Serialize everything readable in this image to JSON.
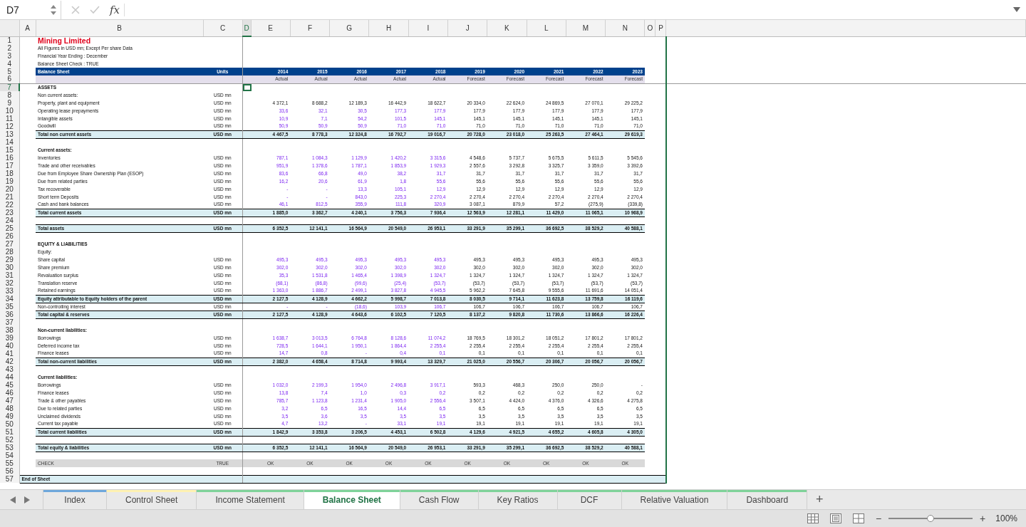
{
  "formula_bar": {
    "name_box": "D7",
    "function_label": "fx"
  },
  "columns": [
    {
      "letter": "A",
      "selected": false
    },
    {
      "letter": "B",
      "selected": false
    },
    {
      "letter": "C",
      "selected": false
    },
    {
      "letter": "D",
      "selected": true
    },
    {
      "letter": "E",
      "selected": false
    },
    {
      "letter": "F",
      "selected": false
    },
    {
      "letter": "G",
      "selected": false
    },
    {
      "letter": "H",
      "selected": false
    },
    {
      "letter": "I",
      "selected": false
    },
    {
      "letter": "J",
      "selected": false
    },
    {
      "letter": "K",
      "selected": false
    },
    {
      "letter": "L",
      "selected": false
    },
    {
      "letter": "M",
      "selected": false
    },
    {
      "letter": "N",
      "selected": false
    },
    {
      "letter": "O",
      "selected": false
    },
    {
      "letter": "P",
      "selected": false
    }
  ],
  "periods": [
    {
      "year": "2014",
      "basis": "Actual",
      "kind": "actual"
    },
    {
      "year": "2015",
      "basis": "Actual",
      "kind": "actual"
    },
    {
      "year": "2016",
      "basis": "Actual",
      "kind": "actual"
    },
    {
      "year": "2017",
      "basis": "Actual",
      "kind": "actual"
    },
    {
      "year": "2018",
      "basis": "Actual",
      "kind": "actual"
    },
    {
      "year": "2019",
      "basis": "Forecast",
      "kind": "forecast"
    },
    {
      "year": "2020",
      "basis": "Forecast",
      "kind": "forecast"
    },
    {
      "year": "2021",
      "basis": "Forecast",
      "kind": "forecast"
    },
    {
      "year": "2022",
      "basis": "Forecast",
      "kind": "forecast"
    },
    {
      "year": "2023",
      "basis": "Forecast",
      "kind": "forecast"
    }
  ],
  "rows": [
    {
      "n": "1",
      "kind": "title",
      "label": "Mining Limited",
      "selected": false
    },
    {
      "n": "2",
      "kind": "note",
      "label": "All Figures in USD mn; Except Per share Data",
      "selected": false
    },
    {
      "n": "3",
      "kind": "note",
      "label": "Financial Year Ending : December",
      "selected": false
    },
    {
      "n": "4",
      "kind": "note",
      "label": "Balance Sheet Check : TRUE",
      "selected": false
    },
    {
      "n": "5",
      "kind": "header",
      "label": "Balance Sheet",
      "units": "Units",
      "selected": false
    },
    {
      "n": "6",
      "kind": "subheader",
      "selected": false
    },
    {
      "n": "7",
      "kind": "section",
      "label": "ASSETS",
      "selected": true
    },
    {
      "n": "8",
      "kind": "item",
      "label": "Non current assets:",
      "units": "USD mn",
      "selected": false
    },
    {
      "n": "9",
      "kind": "item",
      "label": "Property, plant and equipment",
      "units": "USD mn",
      "input": false,
      "selected": false,
      "values": [
        "4 372,1",
        "8 688,2",
        "12 189,3",
        "16 442,9",
        "18 622,7",
        "20 334,0",
        "22 624,0",
        "24 869,5",
        "27 070,1",
        "29 225,2"
      ]
    },
    {
      "n": "10",
      "kind": "item",
      "label": "Operating lease prepayments",
      "units": "USD mn",
      "input": true,
      "selected": false,
      "values": [
        "33,6",
        "32,1",
        "30,5",
        "177,3",
        "177,9",
        "177,9",
        "177,9",
        "177,9",
        "177,9",
        "177,9"
      ]
    },
    {
      "n": "11",
      "kind": "item",
      "label": "Intangible assets",
      "units": "USD mn",
      "input": true,
      "selected": false,
      "values": [
        "10,9",
        "7,1",
        "54,2",
        "101,5",
        "145,1",
        "145,1",
        "145,1",
        "145,1",
        "145,1",
        "145,1"
      ]
    },
    {
      "n": "12",
      "kind": "item",
      "label": "Goodwill",
      "units": "USD mn",
      "input": true,
      "selected": false,
      "values": [
        "50,9",
        "50,9",
        "50,9",
        "71,0",
        "71,0",
        "71,0",
        "71,0",
        "71,0",
        "71,0",
        "71,0"
      ]
    },
    {
      "n": "13",
      "kind": "total",
      "label": "Total non current assets",
      "units": "USD mn",
      "selected": false,
      "values": [
        "4 467,5",
        "8 778,3",
        "12 324,8",
        "16 792,7",
        "19 016,7",
        "20 728,0",
        "23 018,0",
        "25 263,5",
        "27 464,1",
        "29 619,3"
      ]
    },
    {
      "n": "14",
      "kind": "blank",
      "selected": false
    },
    {
      "n": "15",
      "kind": "section",
      "label": "Current assets:",
      "selected": false
    },
    {
      "n": "16",
      "kind": "item",
      "label": "Inventories",
      "units": "USD mn",
      "input": true,
      "selected": false,
      "values": [
        "787,1",
        "1 084,3",
        "1 129,9",
        "1 420,2",
        "3 315,6",
        "4 548,6",
        "5 737,7",
        "5 675,5",
        "5 611,5",
        "5 545,6"
      ]
    },
    {
      "n": "17",
      "kind": "item",
      "label": "Trade and other receivables",
      "units": "USD mn",
      "input": true,
      "selected": false,
      "values": [
        "951,9",
        "1 378,6",
        "1 787,1",
        "1 853,9",
        "1 929,3",
        "2 557,6",
        "3 292,8",
        "3 325,7",
        "3 359,0",
        "3 392,6"
      ]
    },
    {
      "n": "18",
      "kind": "item",
      "label": "Due from Employee Share Ownership Plan (ESOP)",
      "units": "USD mn",
      "input": true,
      "selected": false,
      "values": [
        "83,6",
        "66,8",
        "49,0",
        "38,2",
        "31,7",
        "31,7",
        "31,7",
        "31,7",
        "31,7",
        "31,7"
      ]
    },
    {
      "n": "19",
      "kind": "item",
      "label": "Due from related parties",
      "units": "USD mn",
      "input": true,
      "selected": false,
      "values": [
        "16,2",
        "20,6",
        "61,9",
        "1,8",
        "55,6",
        "55,6",
        "55,6",
        "55,6",
        "55,6",
        "55,6"
      ]
    },
    {
      "n": "20",
      "kind": "item",
      "label": "Tax recoverable",
      "units": "USD mn",
      "input": true,
      "selected": false,
      "values": [
        "-",
        "-",
        "13,3",
        "105,1",
        "12,9",
        "12,9",
        "12,9",
        "12,9",
        "12,9",
        "12,9"
      ]
    },
    {
      "n": "21",
      "kind": "item",
      "label": "Short term Deposits",
      "units": "USD mn",
      "input": true,
      "selected": false,
      "values": [
        "-",
        "-",
        "843,0",
        "225,3",
        "2 270,4",
        "2 270,4",
        "2 270,4",
        "2 270,4",
        "2 270,4",
        "2 270,4"
      ]
    },
    {
      "n": "22",
      "kind": "item",
      "label": "Cash and bank balances",
      "units": "USD mn",
      "input": true,
      "selected": false,
      "values": [
        "46,1",
        "812,5",
        "355,9",
        "111,8",
        "320,9",
        "3 087,1",
        "879,9",
        "57,2",
        "(275,9)",
        "(339,8)"
      ]
    },
    {
      "n": "23",
      "kind": "total",
      "label": "Total current assets",
      "units": "USD mn",
      "selected": false,
      "values": [
        "1 885,0",
        "3 362,7",
        "4 240,1",
        "3 756,3",
        "7 936,4",
        "12 563,9",
        "12 281,1",
        "11 429,0",
        "11 065,1",
        "10 968,9"
      ]
    },
    {
      "n": "24",
      "kind": "blank",
      "selected": false
    },
    {
      "n": "25",
      "kind": "total",
      "label": "Total assets",
      "units": "USD mn",
      "selected": false,
      "values": [
        "6 352,5",
        "12 141,1",
        "16 564,9",
        "20 549,0",
        "26 953,1",
        "33 291,9",
        "35 299,1",
        "36 692,5",
        "38 529,2",
        "40 588,1"
      ]
    },
    {
      "n": "26",
      "kind": "blank",
      "selected": false
    },
    {
      "n": "27",
      "kind": "section",
      "label": "EQUITY & LIABILITIES",
      "selected": false
    },
    {
      "n": "28",
      "kind": "item",
      "label": "Equity:",
      "selected": false
    },
    {
      "n": "29",
      "kind": "item",
      "label": "Share capital",
      "units": "USD mn",
      "input": true,
      "selected": false,
      "values": [
        "495,3",
        "495,3",
        "495,3",
        "495,3",
        "495,3",
        "495,3",
        "495,3",
        "495,3",
        "495,3",
        "495,3"
      ]
    },
    {
      "n": "30",
      "kind": "item",
      "label": "Share premium",
      "units": "USD mn",
      "input": true,
      "selected": false,
      "values": [
        "302,0",
        "302,0",
        "302,0",
        "302,0",
        "302,0",
        "302,0",
        "302,0",
        "302,0",
        "302,0",
        "302,0"
      ]
    },
    {
      "n": "31",
      "kind": "item",
      "label": "Revaluation surplus",
      "units": "USD mn",
      "input": true,
      "selected": false,
      "values": [
        "35,3",
        "1 531,8",
        "1 465,4",
        "1 398,9",
        "1 324,7",
        "1 324,7",
        "1 324,7",
        "1 324,7",
        "1 324,7",
        "1 324,7"
      ]
    },
    {
      "n": "32",
      "kind": "item",
      "label": "Translation reserve",
      "units": "USD mn",
      "input": true,
      "selected": false,
      "values": [
        "(68,1)",
        "(86,8)",
        "(99,6)",
        "(25,4)",
        "(53,7)",
        "(53,7)",
        "(53,7)",
        "(53,7)",
        "(53,7)",
        "(53,7)"
      ]
    },
    {
      "n": "33",
      "kind": "item",
      "label": "Retained earnings",
      "units": "USD mn",
      "input": true,
      "selected": false,
      "values": [
        "1 363,0",
        "1 886,7",
        "2 499,1",
        "3 827,8",
        "4 945,5",
        "5 962,2",
        "7 645,8",
        "9 555,6",
        "11 691,6",
        "14 051,4"
      ]
    },
    {
      "n": "34",
      "kind": "total",
      "label": "Equity attributable to Equity holders of the parent",
      "units": "USD mn",
      "selected": false,
      "values": [
        "2 127,5",
        "4 128,9",
        "4 662,2",
        "5 998,7",
        "7 013,8",
        "8 030,5",
        "9 714,1",
        "11 623,8",
        "13 759,8",
        "16 119,6"
      ]
    },
    {
      "n": "35",
      "kind": "item",
      "label": "Non-controlling interest",
      "units": "USD mn",
      "input": true,
      "selected": false,
      "values": [
        "-",
        "-",
        "(18,6)",
        "103,9",
        "106,7",
        "106,7",
        "106,7",
        "106,7",
        "106,7",
        "106,7"
      ]
    },
    {
      "n": "36",
      "kind": "total",
      "label": "Total capital & reserves",
      "units": "USD mn",
      "selected": false,
      "values": [
        "2 127,5",
        "4 128,9",
        "4 643,6",
        "6 102,5",
        "7 120,5",
        "8 137,2",
        "9 820,8",
        "11 730,6",
        "13 866,6",
        "16 226,4"
      ]
    },
    {
      "n": "37",
      "kind": "blank",
      "selected": false
    },
    {
      "n": "38",
      "kind": "section",
      "label": "Non-current liabilities:",
      "selected": false
    },
    {
      "n": "39",
      "kind": "item",
      "label": "Borrowings",
      "units": "USD mn",
      "input": true,
      "selected": false,
      "values": [
        "1 638,7",
        "3 013,5",
        "6 764,8",
        "8 128,6",
        "11 074,2",
        "18 769,5",
        "18 301,2",
        "18 051,2",
        "17 801,2",
        "17 801,2"
      ]
    },
    {
      "n": "40",
      "kind": "item",
      "label": "Deferred income tax",
      "units": "USD mn",
      "input": true,
      "selected": false,
      "values": [
        "728,5",
        "1 644,1",
        "1 950,1",
        "1 864,4",
        "2 255,4",
        "2 255,4",
        "2 255,4",
        "2 255,4",
        "2 255,4",
        "2 255,4"
      ]
    },
    {
      "n": "41",
      "kind": "item",
      "label": "Finance leases",
      "units": "USD mn",
      "input": true,
      "selected": false,
      "values": [
        "14,7",
        "0,8",
        "-",
        "0,4",
        "0,1",
        "0,1",
        "0,1",
        "0,1",
        "0,1",
        "0,1"
      ]
    },
    {
      "n": "42",
      "kind": "total",
      "label": "Total non-current liabilities",
      "units": "USD mn",
      "selected": false,
      "values": [
        "2 382,0",
        "4 658,4",
        "8 714,8",
        "9 993,4",
        "13 329,7",
        "21 025,0",
        "20 556,7",
        "20 306,7",
        "20 056,7",
        "20 056,7"
      ]
    },
    {
      "n": "43",
      "kind": "blank",
      "selected": false
    },
    {
      "n": "44",
      "kind": "section",
      "label": "Current liabilities:",
      "selected": false
    },
    {
      "n": "45",
      "kind": "item",
      "label": "Borrowings",
      "units": "USD mn",
      "input": true,
      "selected": false,
      "values": [
        "1 032,0",
        "2 199,3",
        "1 954,0",
        "2 496,8",
        "3 917,1",
        "593,3",
        "468,3",
        "250,0",
        "250,0",
        "-"
      ]
    },
    {
      "n": "46",
      "kind": "item",
      "label": "Finance leases",
      "units": "USD mn",
      "input": true,
      "selected": false,
      "values": [
        "13,8",
        "7,4",
        "1,0",
        "0,3",
        "0,2",
        "0,2",
        "0,2",
        "0,2",
        "0,2",
        "0,2"
      ]
    },
    {
      "n": "47",
      "kind": "item",
      "label": "Trade & other payables",
      "units": "USD mn",
      "input": true,
      "selected": false,
      "values": [
        "785,7",
        "1 123,8",
        "1 231,4",
        "1 905,0",
        "2 556,4",
        "3 507,1",
        "4 424,0",
        "4 376,0",
        "4 326,6",
        "4 275,8"
      ]
    },
    {
      "n": "48",
      "kind": "item",
      "label": "Due to related parties",
      "units": "USD mn",
      "input": true,
      "selected": false,
      "values": [
        "3,2",
        "6,5",
        "16,5",
        "14,4",
        "6,5",
        "6,5",
        "6,5",
        "6,5",
        "6,5",
        "6,5"
      ]
    },
    {
      "n": "49",
      "kind": "item",
      "label": "Unclaimed dividends",
      "units": "USD mn",
      "input": true,
      "selected": false,
      "values": [
        "3,5",
        "3,6",
        "3,5",
        "3,5",
        "3,5",
        "3,5",
        "3,5",
        "3,5",
        "3,5",
        "3,5"
      ]
    },
    {
      "n": "50",
      "kind": "item",
      "label": "Current tax payable",
      "units": "USD mn",
      "input": true,
      "selected": false,
      "values": [
        "4,7",
        "13,2",
        "-",
        "33,1",
        "19,1",
        "19,1",
        "19,1",
        "19,1",
        "19,1",
        "19,1"
      ]
    },
    {
      "n": "51",
      "kind": "total",
      "label": "Total current liabilities",
      "units": "USD mn",
      "selected": false,
      "values": [
        "1 842,9",
        "3 353,8",
        "3 206,5",
        "4 453,1",
        "6 502,8",
        "4 129,6",
        "4 921,5",
        "4 655,2",
        "4 605,8",
        "4 305,0"
      ]
    },
    {
      "n": "52",
      "kind": "blank",
      "selected": false
    },
    {
      "n": "53",
      "kind": "total",
      "label": "Total equity & liabilities",
      "units": "USD mn",
      "selected": false,
      "values": [
        "6 352,5",
        "12 141,1",
        "16 564,9",
        "20 549,0",
        "26 953,1",
        "33 291,9",
        "35 299,1",
        "36 692,5",
        "38 529,2",
        "40 588,1"
      ]
    },
    {
      "n": "54",
      "kind": "blank",
      "selected": false
    },
    {
      "n": "55",
      "kind": "check",
      "label": "CHECK",
      "units": "TRUE",
      "selected": false,
      "values": [
        "OK",
        "OK",
        "OK",
        "OK",
        "OK",
        "OK",
        "OK",
        "OK",
        "OK",
        "OK"
      ]
    },
    {
      "n": "56",
      "kind": "blank",
      "selected": false
    },
    {
      "n": "57",
      "kind": "end",
      "label": "End of Sheet",
      "selected": false
    }
  ],
  "sheet_tabs": [
    {
      "label": "Index",
      "selected": false,
      "color": "#6fa8dc"
    },
    {
      "label": "Control Sheet",
      "selected": false,
      "color": "#fff2b3"
    },
    {
      "label": "Income Statement",
      "selected": false,
      "color": "#7fd39a"
    },
    {
      "label": "Balance Sheet",
      "selected": true,
      "color": "#7fd39a"
    },
    {
      "label": "Cash Flow",
      "selected": false,
      "color": "#7fd39a"
    },
    {
      "label": "Key Ratios",
      "selected": false,
      "color": "#7fd39a"
    },
    {
      "label": "DCF",
      "selected": false,
      "color": "#7fd39a"
    },
    {
      "label": "Relative Valuation",
      "selected": false,
      "color": "#7fd39a"
    },
    {
      "label": "Dashboard",
      "selected": false,
      "color": "#7fd39a"
    }
  ],
  "add_sheet": "+",
  "status_bar": {
    "zoom_out": "−",
    "zoom_in": "+",
    "zoom": {
      "level": 0.5
    },
    "zoom_value": "100%"
  }
}
